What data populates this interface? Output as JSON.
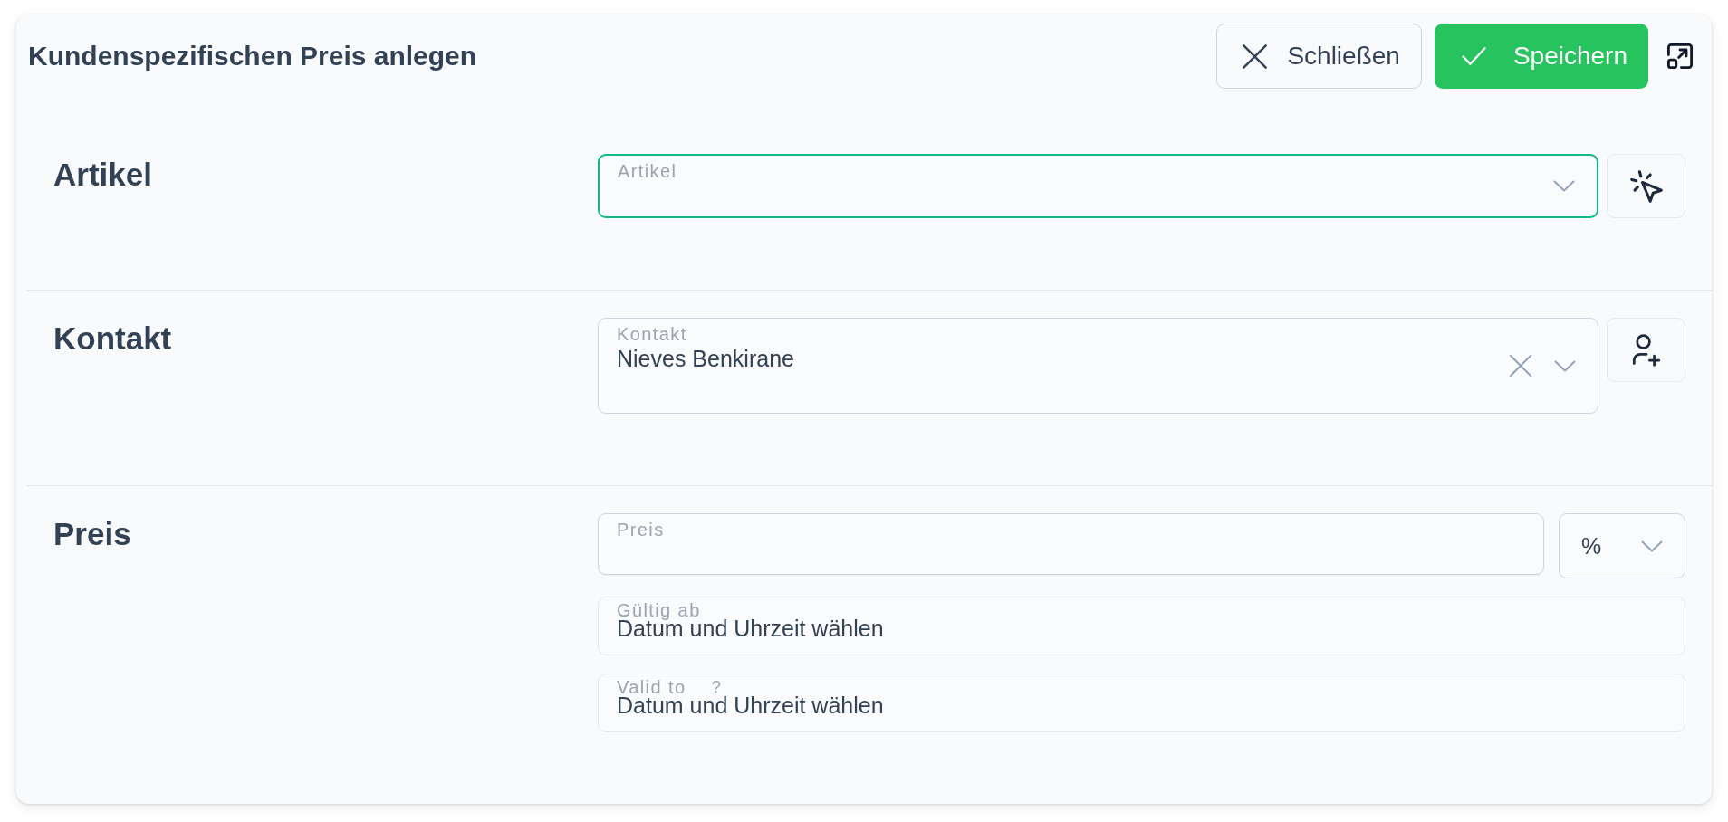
{
  "header": {
    "title": "Kundenspezifischen Preis anlegen",
    "buttons": [
      {
        "kind": "close",
        "label": "Schließen"
      },
      {
        "kind": "save",
        "label": "Speichern"
      }
    ]
  },
  "sections": [
    {
      "title": "Artikel",
      "rows": [
        {
          "kind": "select",
          "label": "Artikel",
          "focused": true,
          "clearable": false,
          "action": {
            "kind": "pick"
          }
        }
      ]
    },
    {
      "title": "Kontakt",
      "rows": [
        {
          "kind": "select",
          "label": "Kontakt",
          "value": "Nieves Benkirane",
          "focused": false,
          "clearable": true,
          "action": {
            "kind": "add-contact"
          }
        }
      ]
    },
    {
      "title": "Preis",
      "rows": [
        {
          "kind": "amount",
          "label": "Preis",
          "focused": false,
          "unit": "%"
        },
        {
          "kind": "datetime",
          "label": "Gültig ab",
          "focused": false,
          "placeholder": "Datum und Uhrzeit wählen"
        },
        {
          "kind": "datetime",
          "label": "Valid to",
          "help": "?",
          "focused": false,
          "placeholder": "Datum und Uhrzeit wählen"
        }
      ]
    }
  ]
}
